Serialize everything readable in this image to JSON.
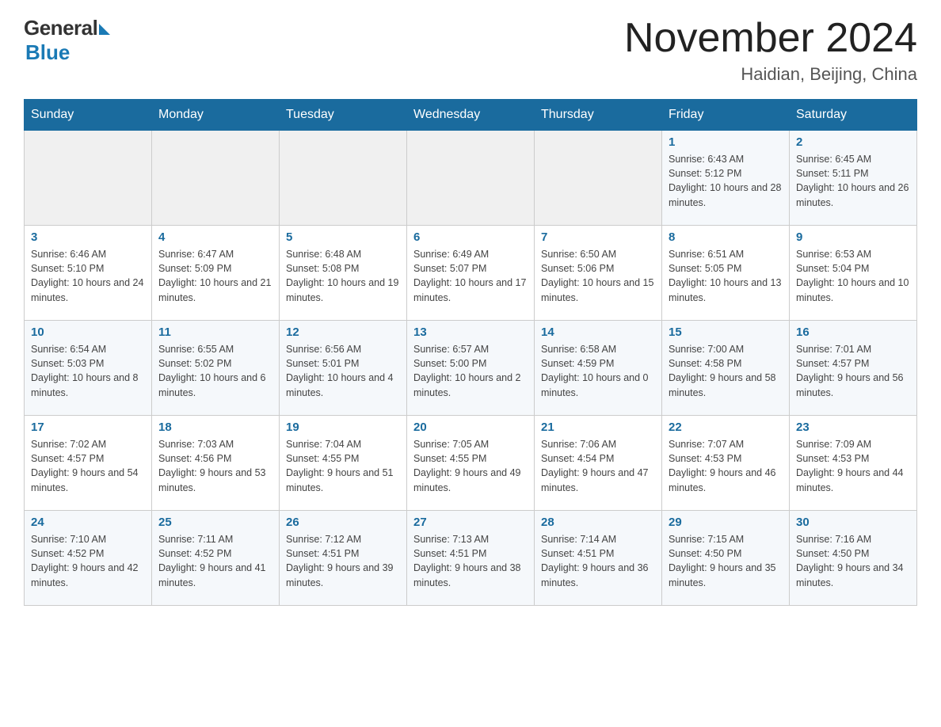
{
  "header": {
    "logo_general": "General",
    "logo_blue": "Blue",
    "month_year": "November 2024",
    "location": "Haidian, Beijing, China"
  },
  "weekdays": [
    "Sunday",
    "Monday",
    "Tuesday",
    "Wednesday",
    "Thursday",
    "Friday",
    "Saturday"
  ],
  "weeks": [
    [
      {
        "day": "",
        "info": ""
      },
      {
        "day": "",
        "info": ""
      },
      {
        "day": "",
        "info": ""
      },
      {
        "day": "",
        "info": ""
      },
      {
        "day": "",
        "info": ""
      },
      {
        "day": "1",
        "info": "Sunrise: 6:43 AM\nSunset: 5:12 PM\nDaylight: 10 hours and 28 minutes."
      },
      {
        "day": "2",
        "info": "Sunrise: 6:45 AM\nSunset: 5:11 PM\nDaylight: 10 hours and 26 minutes."
      }
    ],
    [
      {
        "day": "3",
        "info": "Sunrise: 6:46 AM\nSunset: 5:10 PM\nDaylight: 10 hours and 24 minutes."
      },
      {
        "day": "4",
        "info": "Sunrise: 6:47 AM\nSunset: 5:09 PM\nDaylight: 10 hours and 21 minutes."
      },
      {
        "day": "5",
        "info": "Sunrise: 6:48 AM\nSunset: 5:08 PM\nDaylight: 10 hours and 19 minutes."
      },
      {
        "day": "6",
        "info": "Sunrise: 6:49 AM\nSunset: 5:07 PM\nDaylight: 10 hours and 17 minutes."
      },
      {
        "day": "7",
        "info": "Sunrise: 6:50 AM\nSunset: 5:06 PM\nDaylight: 10 hours and 15 minutes."
      },
      {
        "day": "8",
        "info": "Sunrise: 6:51 AM\nSunset: 5:05 PM\nDaylight: 10 hours and 13 minutes."
      },
      {
        "day": "9",
        "info": "Sunrise: 6:53 AM\nSunset: 5:04 PM\nDaylight: 10 hours and 10 minutes."
      }
    ],
    [
      {
        "day": "10",
        "info": "Sunrise: 6:54 AM\nSunset: 5:03 PM\nDaylight: 10 hours and 8 minutes."
      },
      {
        "day": "11",
        "info": "Sunrise: 6:55 AM\nSunset: 5:02 PM\nDaylight: 10 hours and 6 minutes."
      },
      {
        "day": "12",
        "info": "Sunrise: 6:56 AM\nSunset: 5:01 PM\nDaylight: 10 hours and 4 minutes."
      },
      {
        "day": "13",
        "info": "Sunrise: 6:57 AM\nSunset: 5:00 PM\nDaylight: 10 hours and 2 minutes."
      },
      {
        "day": "14",
        "info": "Sunrise: 6:58 AM\nSunset: 4:59 PM\nDaylight: 10 hours and 0 minutes."
      },
      {
        "day": "15",
        "info": "Sunrise: 7:00 AM\nSunset: 4:58 PM\nDaylight: 9 hours and 58 minutes."
      },
      {
        "day": "16",
        "info": "Sunrise: 7:01 AM\nSunset: 4:57 PM\nDaylight: 9 hours and 56 minutes."
      }
    ],
    [
      {
        "day": "17",
        "info": "Sunrise: 7:02 AM\nSunset: 4:57 PM\nDaylight: 9 hours and 54 minutes."
      },
      {
        "day": "18",
        "info": "Sunrise: 7:03 AM\nSunset: 4:56 PM\nDaylight: 9 hours and 53 minutes."
      },
      {
        "day": "19",
        "info": "Sunrise: 7:04 AM\nSunset: 4:55 PM\nDaylight: 9 hours and 51 minutes."
      },
      {
        "day": "20",
        "info": "Sunrise: 7:05 AM\nSunset: 4:55 PM\nDaylight: 9 hours and 49 minutes."
      },
      {
        "day": "21",
        "info": "Sunrise: 7:06 AM\nSunset: 4:54 PM\nDaylight: 9 hours and 47 minutes."
      },
      {
        "day": "22",
        "info": "Sunrise: 7:07 AM\nSunset: 4:53 PM\nDaylight: 9 hours and 46 minutes."
      },
      {
        "day": "23",
        "info": "Sunrise: 7:09 AM\nSunset: 4:53 PM\nDaylight: 9 hours and 44 minutes."
      }
    ],
    [
      {
        "day": "24",
        "info": "Sunrise: 7:10 AM\nSunset: 4:52 PM\nDaylight: 9 hours and 42 minutes."
      },
      {
        "day": "25",
        "info": "Sunrise: 7:11 AM\nSunset: 4:52 PM\nDaylight: 9 hours and 41 minutes."
      },
      {
        "day": "26",
        "info": "Sunrise: 7:12 AM\nSunset: 4:51 PM\nDaylight: 9 hours and 39 minutes."
      },
      {
        "day": "27",
        "info": "Sunrise: 7:13 AM\nSunset: 4:51 PM\nDaylight: 9 hours and 38 minutes."
      },
      {
        "day": "28",
        "info": "Sunrise: 7:14 AM\nSunset: 4:51 PM\nDaylight: 9 hours and 36 minutes."
      },
      {
        "day": "29",
        "info": "Sunrise: 7:15 AM\nSunset: 4:50 PM\nDaylight: 9 hours and 35 minutes."
      },
      {
        "day": "30",
        "info": "Sunrise: 7:16 AM\nSunset: 4:50 PM\nDaylight: 9 hours and 34 minutes."
      }
    ]
  ]
}
